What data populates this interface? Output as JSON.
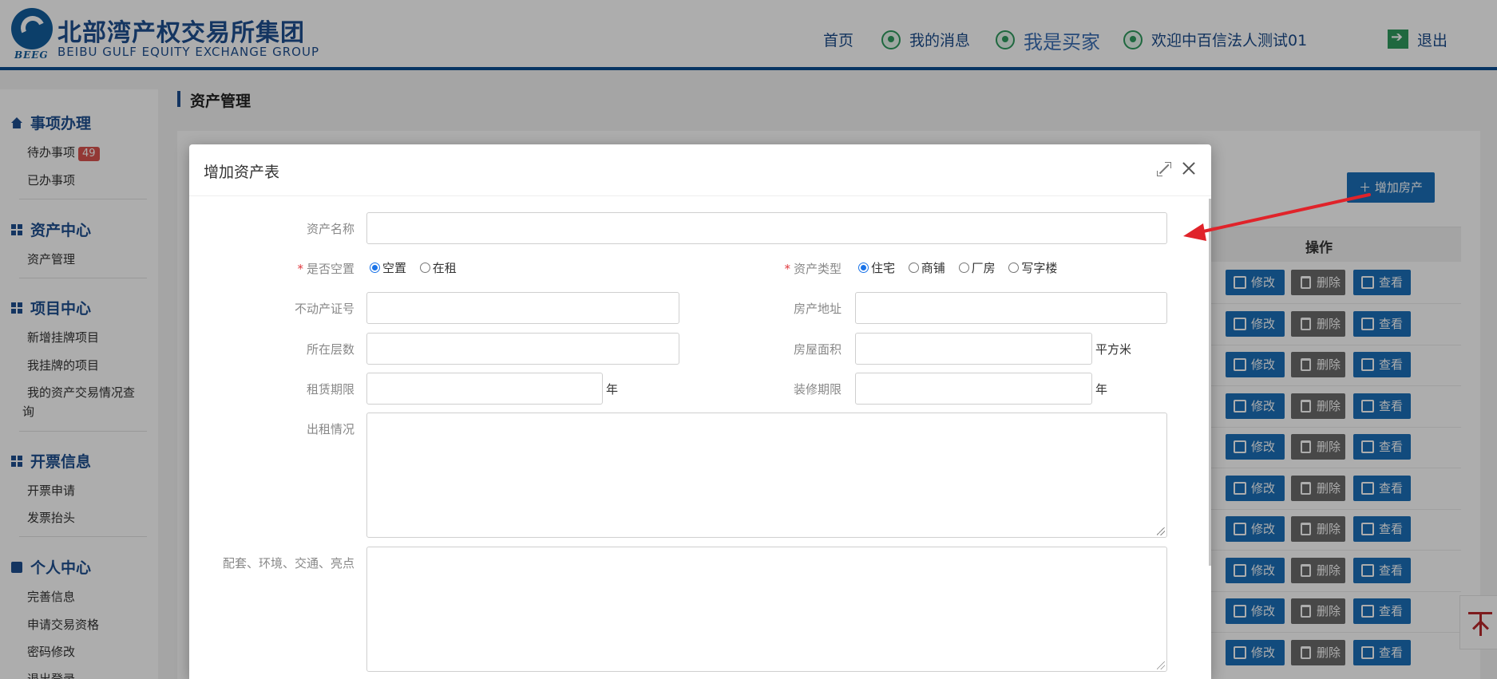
{
  "header": {
    "logo_text": "BEEG",
    "brand_cn": "北部湾产权交易所集团",
    "brand_en": "BEIBU GULF EQUITY EXCHANGE GROUP",
    "nav": {
      "home": "首页",
      "messages": "我的消息",
      "role": "我是买家",
      "welcome": "欢迎中百信法人测试01",
      "logout": "退出"
    }
  },
  "sidebar": {
    "groups": [
      {
        "title": "事项办理",
        "icon": "home-icon",
        "items": [
          {
            "label": "待办事项",
            "badge": "49"
          },
          {
            "label": "已办事项"
          }
        ]
      },
      {
        "title": "资产中心",
        "icon": "grid-icon",
        "items": [
          {
            "label": "资产管理"
          }
        ]
      },
      {
        "title": "项目中心",
        "icon": "grid-icon",
        "items": [
          {
            "label": "新增挂牌项目"
          },
          {
            "label": "我挂牌的项目"
          },
          {
            "label": "我的资产交易情况查"
          }
        ]
      },
      {
        "title": "开票信息",
        "icon": "grid-icon",
        "items": [
          {
            "label": "开票申请"
          },
          {
            "label": "发票抬头"
          }
        ]
      },
      {
        "title": "个人中心",
        "icon": "book-icon",
        "items": [
          {
            "label": "完善信息"
          },
          {
            "label": "申请交易资格"
          },
          {
            "label": "密码修改"
          },
          {
            "label": "退出登录"
          }
        ]
      }
    ],
    "wrap_suffix": "询"
  },
  "page": {
    "title": "资产管理",
    "add_button": "增加房产",
    "table_header": "操作",
    "row_actions": {
      "edit": "修改",
      "delete": "删除",
      "view": "查看"
    }
  },
  "modal": {
    "title": "增加资产表",
    "fields": {
      "asset_name": {
        "label": "资产名称",
        "value": ""
      },
      "vacant": {
        "label": "是否空置",
        "options": [
          "空置",
          "在租"
        ],
        "selected": "空置"
      },
      "asset_type": {
        "label": "资产类型",
        "options": [
          "住宅",
          "商铺",
          "厂房",
          "写字楼"
        ],
        "selected": "住宅"
      },
      "property_cert": {
        "label": "不动产证号",
        "value": ""
      },
      "address": {
        "label": "房产地址",
        "value": ""
      },
      "floor": {
        "label": "所在层数",
        "value": ""
      },
      "area": {
        "label": "房屋面积",
        "value": "",
        "unit": "平方米"
      },
      "lease_term": {
        "label": "租赁期限",
        "value": "",
        "unit": "年"
      },
      "decor_term": {
        "label": "装修期限",
        "value": "",
        "unit": "年"
      },
      "rental": {
        "label": "出租情况",
        "value": ""
      },
      "amenities": {
        "label": "配套、环境、交通、亮点",
        "value": ""
      }
    }
  },
  "colors": {
    "brand": "#1e4f8f",
    "primary_button": "#1b6fb8",
    "delete_button": "#6b6b6b",
    "required": "#e0393e",
    "arrow": "#e0232a"
  }
}
